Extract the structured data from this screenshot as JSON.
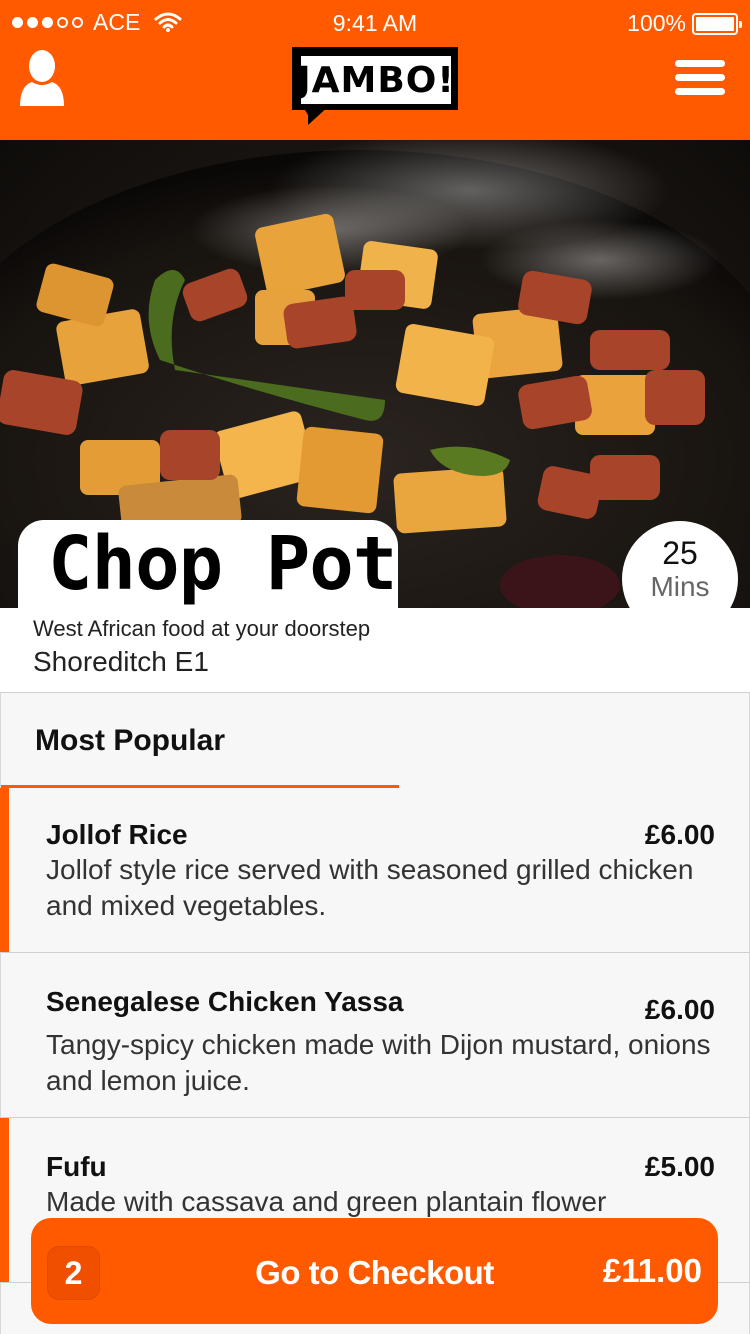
{
  "status_bar": {
    "carrier": "ACE",
    "time": "9:41 AM",
    "battery": "100%"
  },
  "header": {
    "logo_text": "JAMBO!",
    "left_icon": "user-icon",
    "right_icon": "menu-icon"
  },
  "restaurant": {
    "name": "Chop Pot",
    "delivery_time": "25",
    "delivery_unit": "Mins",
    "tagline": "West African food at your doorstep",
    "location": "Shoreditch E1"
  },
  "section": {
    "title": "Most Popular"
  },
  "items": [
    {
      "name": "Jollof Rice",
      "price": "£6.00",
      "description": "Jollof style rice served with seasoned grilled chicken and mixed vegetables."
    },
    {
      "name": "Senegalese Chicken Yassa",
      "price": "£6.00",
      "description": "Tangy-spicy chicken made with Dijon mustard, onions and lemon juice."
    },
    {
      "name": "Fufu",
      "price": "£5.00",
      "description": "Made with cassava and green plantain flower"
    }
  ],
  "checkout": {
    "count": "2",
    "label": "Go to Checkout",
    "total": "£11.00"
  },
  "colors": {
    "brand": "#ff5a00",
    "background": "#f7f7f7"
  }
}
